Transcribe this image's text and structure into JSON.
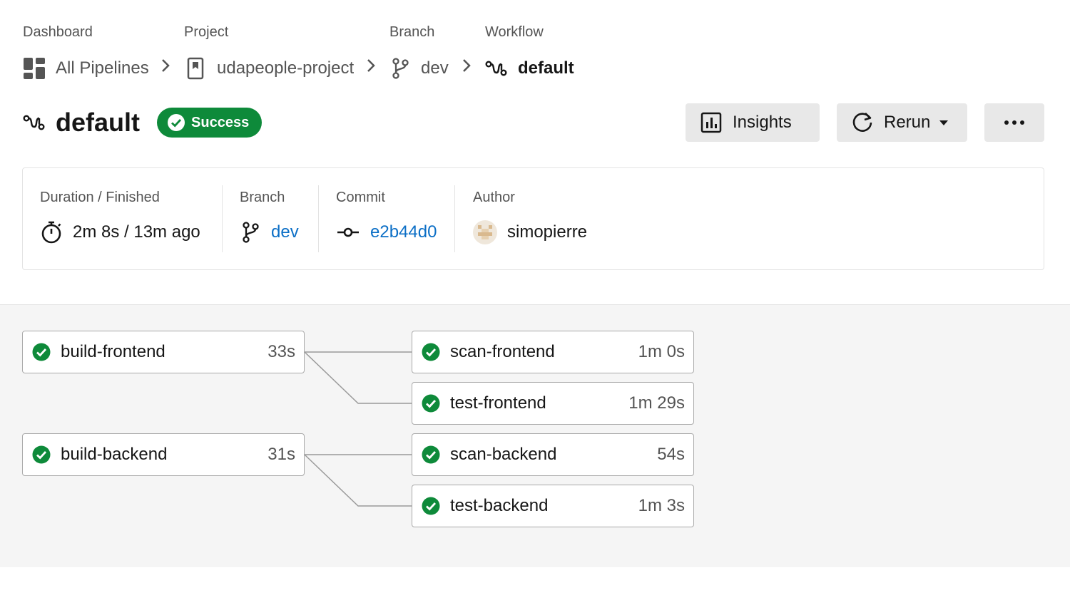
{
  "breadcrumb": {
    "dashboard": {
      "label": "Dashboard",
      "value": "All Pipelines"
    },
    "project": {
      "label": "Project",
      "value": "udapeople-project"
    },
    "branch": {
      "label": "Branch",
      "value": "dev"
    },
    "workflow": {
      "label": "Workflow",
      "value": "default"
    }
  },
  "header": {
    "title": "default",
    "status": "Success",
    "insights_label": "Insights",
    "rerun_label": "Rerun"
  },
  "info": {
    "duration_label": "Duration / Finished",
    "duration_value": "2m 8s / 13m ago",
    "branch_label": "Branch",
    "branch_value": "dev",
    "commit_label": "Commit",
    "commit_value": "e2b44d0",
    "author_label": "Author",
    "author_value": "simopierre"
  },
  "jobs": [
    {
      "name": "build-frontend",
      "duration": "33s",
      "status": "success"
    },
    {
      "name": "scan-frontend",
      "duration": "1m 0s",
      "status": "success"
    },
    {
      "name": "test-frontend",
      "duration": "1m 29s",
      "status": "success"
    },
    {
      "name": "build-backend",
      "duration": "31s",
      "status": "success"
    },
    {
      "name": "scan-backend",
      "duration": "54s",
      "status": "success"
    },
    {
      "name": "test-backend",
      "duration": "1m 3s",
      "status": "success"
    }
  ],
  "icons": {
    "dashboard": "dashboard-grid-icon",
    "project": "bookmark-icon",
    "branch": "git-branch-icon",
    "workflow": "workflow-icon",
    "insights": "bar-chart-icon",
    "rerun": "refresh-icon",
    "more": "ellipsis-icon",
    "duration": "stopwatch-icon",
    "commit": "git-commit-icon",
    "success": "check-circle-icon"
  },
  "colors": {
    "success": "#0e8a3a",
    "link": "#0c6fc6",
    "button_bg": "#e8e8e8",
    "graph_bg": "#f5f5f5"
  }
}
